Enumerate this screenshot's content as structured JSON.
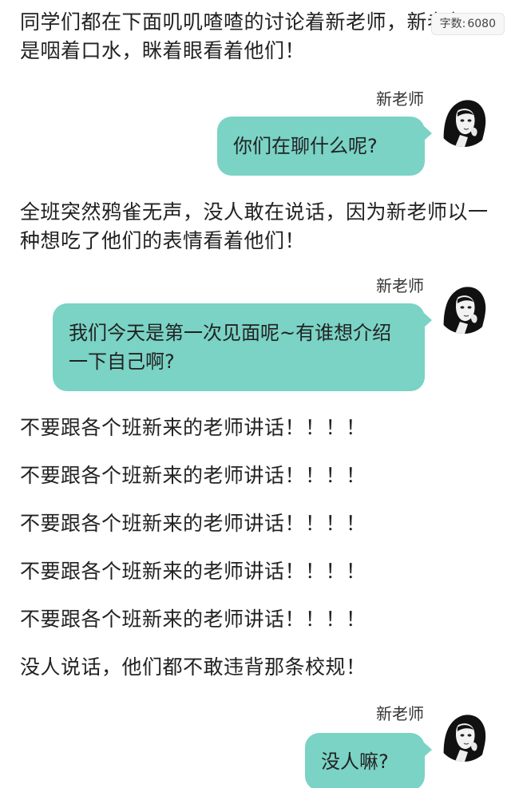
{
  "word_count": {
    "label": "字数:",
    "value": "6080"
  },
  "story": {
    "p1": "同学们都在下面叽叽喳喳的讨论着新老师，新老师只是咽着口水，眯着眼看着他们！",
    "p2": "全班突然鸦雀无声，没人敢在说话，因为新老师以一种想吃了他们的表情看着他们！",
    "rules": [
      "不要跟各个班新来的老师讲话！！！！",
      "不要跟各个班新来的老师讲话！！！！",
      "不要跟各个班新来的老师讲话！！！！",
      "不要跟各个班新来的老师讲话！！！！",
      "不要跟各个班新来的老师讲话！！！！"
    ],
    "p3": "没人说话，他们都不敢违背那条校规！"
  },
  "messages": [
    {
      "sender": "新老师",
      "text": "你们在聊什么呢?"
    },
    {
      "sender": "新老师",
      "text": "我们今天是第一次见面呢~有谁想介绍一下自己啊?"
    },
    {
      "sender": "新老师",
      "text": "没人嘛?"
    }
  ],
  "colors": {
    "bubble": "#7ad3c5",
    "text": "#222222",
    "background": "#ffffff"
  },
  "icons": {
    "avatar": "teacher-avatar-portrait"
  }
}
